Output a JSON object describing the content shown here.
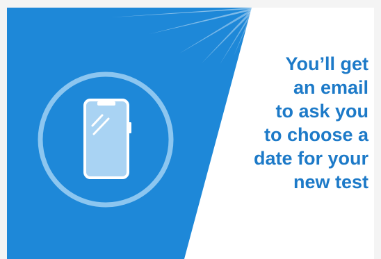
{
  "colors": {
    "panel_blue": "#1e88d8",
    "panel_blue_light": "#2a93e0",
    "text_blue": "#1d7ac8",
    "ring": "#8cc6f0",
    "phone_fill": "#a9d3f3",
    "background": "#ffffff"
  },
  "icons": {
    "hero": "smartphone-icon",
    "ring": "circle-ring-icon",
    "rays": "light-rays-icon"
  },
  "message": {
    "lines": [
      "You’ll get",
      "an email",
      "to ask you",
      "to choose a",
      "date for your",
      "new test"
    ]
  }
}
